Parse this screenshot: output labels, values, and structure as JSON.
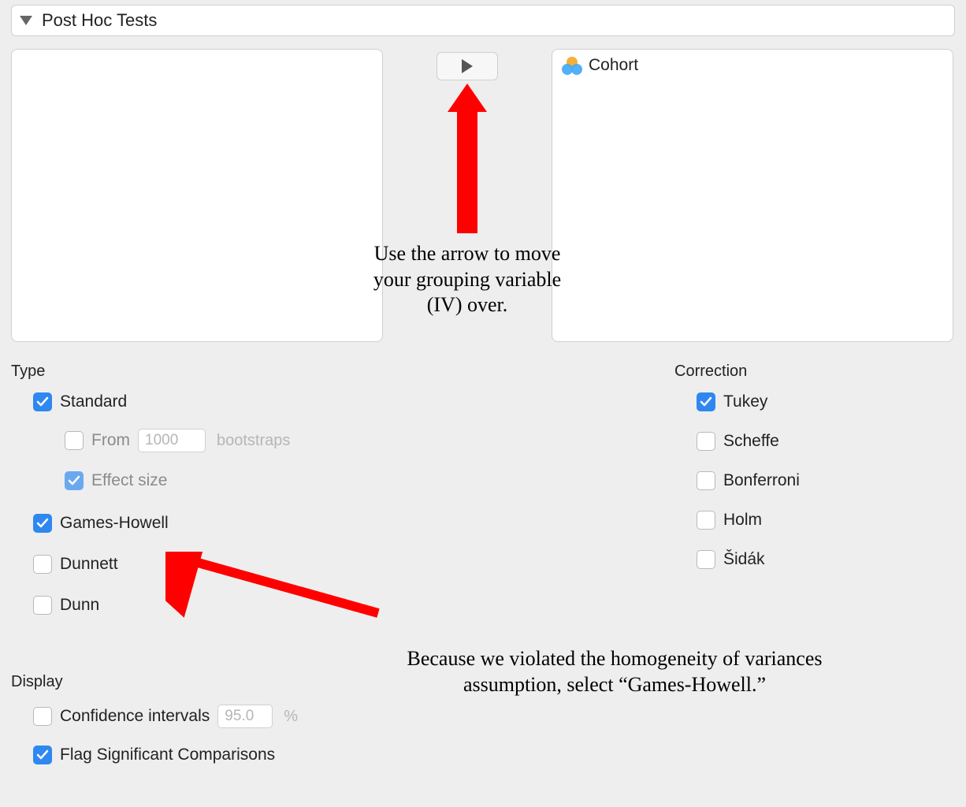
{
  "section": {
    "title": "Post Hoc Tests"
  },
  "move_button_icon": "play-triangle",
  "right_panel": {
    "items": [
      {
        "name": "Cohort"
      }
    ]
  },
  "type": {
    "label": "Type",
    "standard": {
      "label": "Standard",
      "checked": true
    },
    "from": {
      "label": "From",
      "checked": false,
      "value": "1000",
      "suffix": "bootstraps"
    },
    "effect": {
      "label": "Effect size",
      "checked": true
    },
    "games_howell": {
      "label": "Games-Howell",
      "checked": true
    },
    "dunnett": {
      "label": "Dunnett",
      "checked": false
    },
    "dunn": {
      "label": "Dunn",
      "checked": false
    }
  },
  "display": {
    "label": "Display",
    "ci": {
      "label": "Confidence intervals",
      "checked": false,
      "value": "95.0",
      "suffix": "%"
    },
    "flag": {
      "label": "Flag Significant Comparisons",
      "checked": true
    }
  },
  "correction": {
    "label": "Correction",
    "tukey": {
      "label": "Tukey",
      "checked": true
    },
    "scheffe": {
      "label": "Scheffe",
      "checked": false
    },
    "bonf": {
      "label": "Bonferroni",
      "checked": false
    },
    "holm": {
      "label": "Holm",
      "checked": false
    },
    "sidak": {
      "label": "Šidák",
      "checked": false
    }
  },
  "annotations": {
    "a1": "Use the arrow to move your grouping variable (IV) over.",
    "a2": "Because we violated the homogeneity of variances assumption, select “Games-Howell.”"
  }
}
